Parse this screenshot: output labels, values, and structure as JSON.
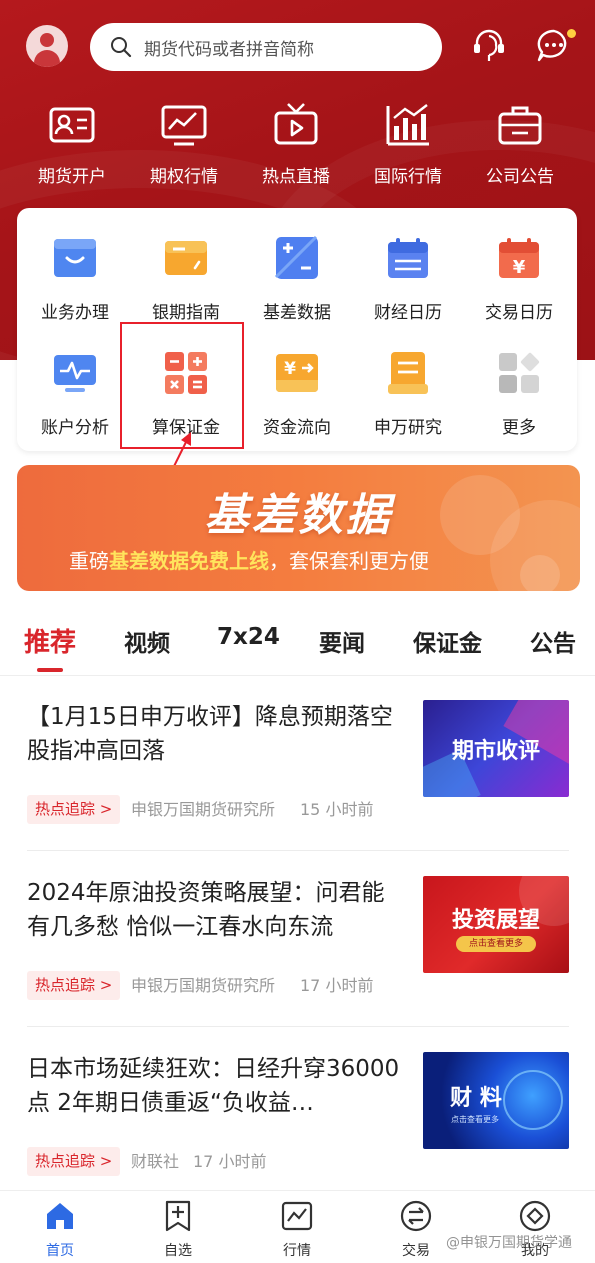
{
  "search": {
    "placeholder": "期货代码或者拼音简称"
  },
  "top_nav": [
    {
      "label": "期货开户",
      "icon": "id-card-icon"
    },
    {
      "label": "期权行情",
      "icon": "chart-monitor-icon"
    },
    {
      "label": "热点直播",
      "icon": "tv-play-icon"
    },
    {
      "label": "国际行情",
      "icon": "bar-chart-icon"
    },
    {
      "label": "公司公告",
      "icon": "briefcase-icon"
    }
  ],
  "grid": [
    {
      "label": "业务办理",
      "icon": "folder-icon"
    },
    {
      "label": "银期指南",
      "icon": "card-icon"
    },
    {
      "label": "基差数据",
      "icon": "plus-minus-icon"
    },
    {
      "label": "财经日历",
      "icon": "calendar-icon"
    },
    {
      "label": "交易日历",
      "icon": "yen-calendar-icon"
    },
    {
      "label": "账户分析",
      "icon": "pulse-monitor-icon"
    },
    {
      "label": "算保证金",
      "icon": "calculator-icon"
    },
    {
      "label": "资金流向",
      "icon": "yen-flow-icon"
    },
    {
      "label": "申万研究",
      "icon": "document-stack-icon"
    },
    {
      "label": "更多",
      "icon": "more-grid-icon"
    }
  ],
  "banner": {
    "title": "基差数据",
    "sub_prefix": "重磅",
    "sub_highlight": "基差数据免费上线",
    "sub_suffix": "，套保套利更方便"
  },
  "tabs": [
    "推荐",
    "视频",
    "7x24",
    "要闻",
    "保证金",
    "公告"
  ],
  "active_tab": "推荐",
  "news": [
    {
      "headline": "【1月15日申万收评】降息预期落空  股指冲高回落",
      "tag": "热点追踪 >",
      "source": "申银万国期货研究所",
      "time": "15 小时前",
      "thumb_text": "期市收评",
      "thumb_sub": ""
    },
    {
      "headline": "2024年原油投资策略展望：问君能有几多愁 恰似一江春水向东流",
      "tag": "热点追踪 >",
      "source": "申银万国期货研究所",
      "time": "17 小时前",
      "thumb_text": "投资展望",
      "thumb_sub": "点击查看更多"
    },
    {
      "headline": "日本市场延续狂欢：日经升穿36000点 2年期日债重返“负收益…",
      "tag": "热点追踪 >",
      "source": "财联社",
      "time": "17 小时前",
      "thumb_text": "财 料",
      "thumb_sub": "点击查看更多"
    }
  ],
  "bottom_nav": [
    {
      "label": "首页",
      "icon": "home-icon",
      "active": true
    },
    {
      "label": "自选",
      "icon": "bookmark-plus-icon",
      "active": false
    },
    {
      "label": "行情",
      "icon": "line-chart-icon",
      "active": false
    },
    {
      "label": "交易",
      "icon": "exchange-icon",
      "active": false
    },
    {
      "label": "我的",
      "icon": "diamond-circle-icon",
      "active": false
    }
  ],
  "watermark": "@申银万国期货学通",
  "colors": {
    "brand_red": "#b5191d",
    "accent_red": "#d9262c",
    "active_blue": "#2d6ae3",
    "banner_orange": "#f47d3f"
  }
}
